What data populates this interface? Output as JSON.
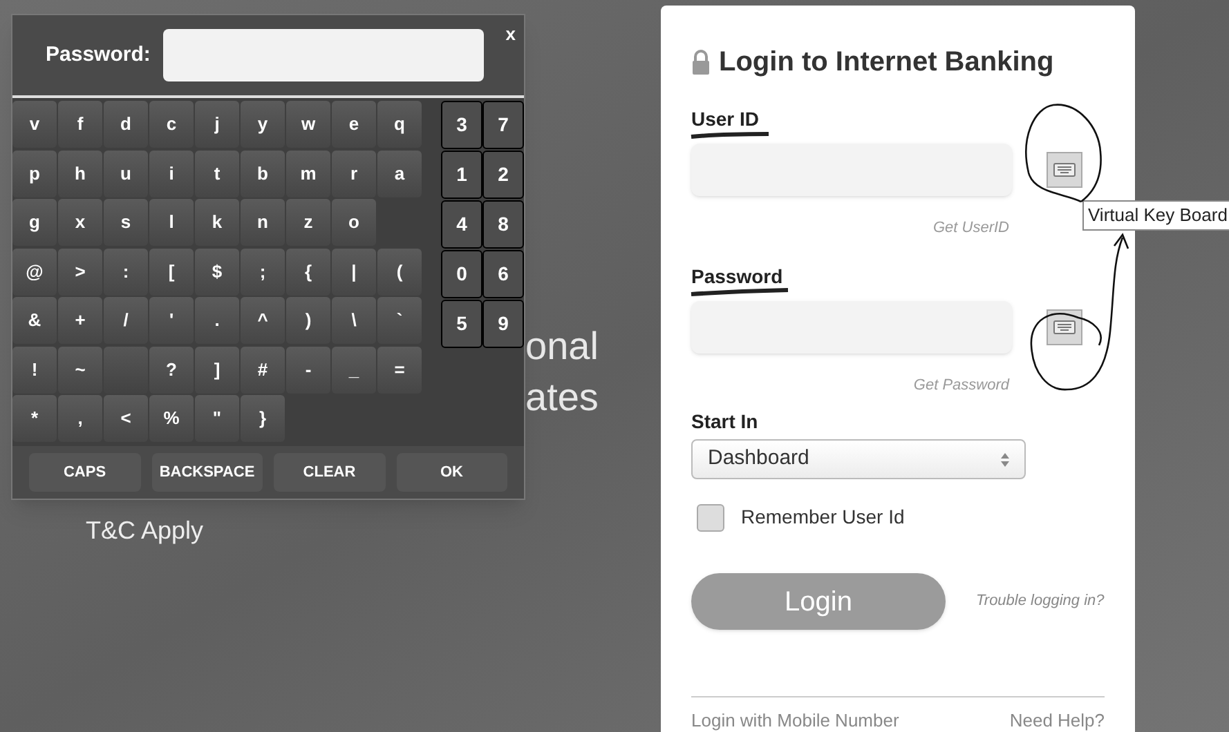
{
  "virtual_keyboard": {
    "close": "x",
    "password_label": "Password:",
    "letter_rows": [
      [
        {
          "label": "v"
        },
        {
          "label": "f"
        },
        {
          "label": "d"
        },
        {
          "label": "c"
        },
        {
          "label": "j"
        },
        {
          "label": "y"
        },
        {
          "label": "w"
        },
        {
          "label": "e"
        },
        {
          "label": "q"
        }
      ],
      [
        {
          "label": "p"
        },
        {
          "label": "h"
        },
        {
          "label": "u"
        },
        {
          "label": "i"
        },
        {
          "label": "t"
        },
        {
          "label": "b"
        },
        {
          "label": "m"
        },
        {
          "label": "r"
        },
        {
          "label": "a"
        }
      ],
      [
        {
          "label": "g"
        },
        {
          "label": "x"
        },
        {
          "label": "s"
        },
        {
          "label": "l"
        },
        {
          "label": "k"
        },
        {
          "label": "n"
        },
        {
          "label": "z"
        },
        {
          "label": "o"
        }
      ],
      [
        {
          "label": "@"
        },
        {
          "label": ">"
        },
        {
          "label": ":"
        },
        {
          "label": "["
        },
        {
          "label": "$"
        },
        {
          "label": ";"
        },
        {
          "label": "{"
        },
        {
          "label": "|"
        },
        {
          "label": "("
        }
      ],
      [
        {
          "label": "&"
        },
        {
          "label": "+"
        },
        {
          "label": "/"
        },
        {
          "label": "'"
        },
        {
          "label": "."
        },
        {
          "label": "^"
        },
        {
          "label": ")"
        },
        {
          "label": "\\"
        },
        {
          "label": "`"
        }
      ],
      [
        {
          "label": "!"
        },
        {
          "label": "~"
        },
        {},
        {
          "label": "?"
        },
        {
          "label": "]"
        },
        {
          "label": "#"
        },
        {
          "label": "-"
        },
        {
          "label": "_"
        },
        {
          "label": "="
        }
      ],
      [
        {
          "label": "*"
        },
        {
          "label": ","
        },
        {
          "label": "<"
        },
        {
          "label": "%"
        },
        {
          "label": "\""
        },
        {
          "label": "}"
        }
      ]
    ],
    "number_rows": [
      [
        "3",
        "7"
      ],
      [
        "1",
        "2"
      ],
      [
        "4",
        "8"
      ],
      [
        "0",
        "6"
      ],
      [
        "5",
        "9"
      ]
    ],
    "buttons": [
      "CAPS",
      "BACKSPACE",
      "CLEAR",
      "OK"
    ]
  },
  "background": {
    "lines": [
      "onal",
      "ates"
    ],
    "terms": "T&C Apply"
  },
  "login": {
    "title": "Login to Internet Banking",
    "user_id": {
      "label": "User ID",
      "link": "Get UserID"
    },
    "password": {
      "label": "Password",
      "link": "Get Password"
    },
    "tooltip": "Virtual Key Board",
    "start_in": {
      "label": "Start In",
      "value": "Dashboard"
    },
    "remember": {
      "label": "Remember User Id",
      "checked": false
    },
    "login_button": "Login",
    "trouble": "Trouble logging in?",
    "footer": [
      "Login with Mobile Number",
      "Need Help?"
    ]
  }
}
